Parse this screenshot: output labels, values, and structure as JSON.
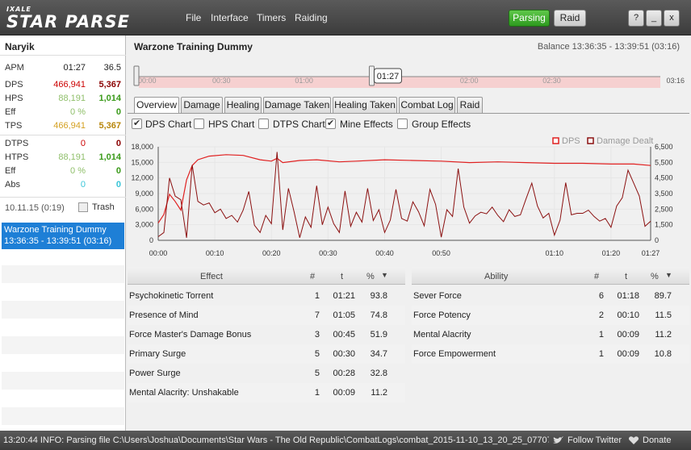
{
  "app": {
    "logo_small": "IXALE",
    "logo_big": "STAR PARSE"
  },
  "menu": [
    "File",
    "Interface",
    "Timers",
    "Raiding"
  ],
  "toolbar": {
    "parsing": "Parsing",
    "raid": "Raid",
    "help": "?",
    "minimize": "_",
    "close": "x"
  },
  "sidebar": {
    "player": "Naryik",
    "stats": [
      {
        "label": "APM",
        "v1": "01:27",
        "v2": "36.5"
      },
      {
        "label": "DPS",
        "v1": "466,941",
        "v2": "5,367"
      },
      {
        "label": "HPS",
        "v1": "88,191",
        "v2": "1,014"
      },
      {
        "label": "Eff",
        "v1": "0 %",
        "v2": "0"
      },
      {
        "label": "TPS",
        "v1": "466,941",
        "v2": "5,367"
      },
      {
        "label": "DTPS",
        "v1": "0",
        "v2": "0"
      },
      {
        "label": "HTPS",
        "v1": "88,191",
        "v2": "1,014"
      },
      {
        "label": "Eff",
        "v1": "0 %",
        "v2": "0"
      },
      {
        "label": "Abs",
        "v1": "0",
        "v2": "0"
      }
    ],
    "combat_date": "10.11.15 (0:19)",
    "trash_label": "Trash",
    "encounter": {
      "name": "Warzone Training Dummy",
      "time": "13:36:35 - 13:39:51 (03:16)"
    }
  },
  "main": {
    "title": "Warzone Training Dummy",
    "balance": "Balance 13:36:35 - 13:39:51 (03:16)",
    "timeline": {
      "ticks": [
        "00:00",
        "00:30",
        "01:00",
        "01:30",
        "02:00",
        "02:30"
      ],
      "end": "03:16",
      "cursor": "01:27",
      "cursor_fraction": 0.445
    },
    "tabs": [
      "Overview",
      "Damage",
      "Healing",
      "Damage Taken",
      "Healing Taken",
      "Combat Log",
      "Raid"
    ],
    "options": [
      {
        "label": "DPS Chart",
        "checked": true
      },
      {
        "label": "HPS Chart",
        "checked": false
      },
      {
        "label": "DTPS Chart",
        "checked": false
      },
      {
        "label": "Mine Effects",
        "checked": true
      },
      {
        "label": "Group Effects",
        "checked": false
      }
    ]
  },
  "chart_data": {
    "type": "line",
    "legend": [
      "DPS",
      "Damage Dealt"
    ],
    "colors": {
      "dps": "#e02020",
      "dealt": "#8b1010"
    },
    "x": [
      "00:00",
      "00:10",
      "00:20",
      "00:30",
      "00:40",
      "00:50",
      "01:10",
      "01:20",
      "01:27"
    ],
    "y_left_ticks": [
      "18,000",
      "15,000",
      "12,000",
      "9,000",
      "6,000",
      "3,000",
      "0"
    ],
    "y_right_ticks": [
      "6,500",
      "5,500",
      "4,500",
      "3,500",
      "2,500",
      "1,500",
      "0"
    ],
    "ylim_left": [
      0,
      18000
    ],
    "ylim_right": [
      0,
      6500
    ],
    "xlim_seconds": [
      0,
      87
    ],
    "series": [
      {
        "name": "DPS",
        "axis": "right",
        "points": [
          [
            0,
            1200
          ],
          [
            1,
            1800
          ],
          [
            2,
            3200
          ],
          [
            3,
            2700
          ],
          [
            4,
            2100
          ],
          [
            5,
            4200
          ],
          [
            6,
            5200
          ],
          [
            7,
            5600
          ],
          [
            9,
            5850
          ],
          [
            12,
            5950
          ],
          [
            15,
            5900
          ],
          [
            18,
            5600
          ],
          [
            20,
            5500
          ],
          [
            21,
            5700
          ],
          [
            22,
            5400
          ],
          [
            25,
            5550
          ],
          [
            28,
            5600
          ],
          [
            32,
            5450
          ],
          [
            35,
            5500
          ],
          [
            40,
            5600
          ],
          [
            45,
            5550
          ],
          [
            50,
            5500
          ],
          [
            55,
            5400
          ],
          [
            60,
            5450
          ],
          [
            65,
            5400
          ],
          [
            70,
            5350
          ],
          [
            75,
            5350
          ],
          [
            80,
            5300
          ],
          [
            84,
            5300
          ],
          [
            87,
            5200
          ]
        ]
      },
      {
        "name": "Damage Dealt",
        "axis": "left",
        "points": [
          [
            0,
            700
          ],
          [
            1,
            1500
          ],
          [
            2,
            12000
          ],
          [
            3,
            8500
          ],
          [
            4,
            7800
          ],
          [
            5,
            500
          ],
          [
            6,
            14500
          ],
          [
            7,
            7500
          ],
          [
            8,
            6800
          ],
          [
            9,
            7200
          ],
          [
            10,
            5300
          ],
          [
            11,
            6000
          ],
          [
            12,
            4200
          ],
          [
            13,
            4800
          ],
          [
            14,
            3500
          ],
          [
            15,
            5800
          ],
          [
            16,
            9400
          ],
          [
            17,
            2900
          ],
          [
            18,
            1500
          ],
          [
            19,
            4800
          ],
          [
            20,
            3200
          ],
          [
            21,
            17000
          ],
          [
            22,
            2000
          ],
          [
            23,
            10000
          ],
          [
            24,
            5500
          ],
          [
            25,
            500
          ],
          [
            26,
            4500
          ],
          [
            27,
            2500
          ],
          [
            28,
            10500
          ],
          [
            29,
            3000
          ],
          [
            30,
            6400
          ],
          [
            31,
            3200
          ],
          [
            32,
            1500
          ],
          [
            33,
            9500
          ],
          [
            34,
            2700
          ],
          [
            35,
            5400
          ],
          [
            36,
            3500
          ],
          [
            37,
            10000
          ],
          [
            38,
            3800
          ],
          [
            39,
            5900
          ],
          [
            40,
            1500
          ],
          [
            41,
            3900
          ],
          [
            42,
            9800
          ],
          [
            43,
            4200
          ],
          [
            44,
            3700
          ],
          [
            45,
            7400
          ],
          [
            46,
            5500
          ],
          [
            47,
            2800
          ],
          [
            48,
            9800
          ],
          [
            49,
            6900
          ],
          [
            50,
            600
          ],
          [
            51,
            5900
          ],
          [
            52,
            4600
          ],
          [
            53,
            13800
          ],
          [
            54,
            6400
          ],
          [
            55,
            3300
          ],
          [
            56,
            4700
          ],
          [
            57,
            5400
          ],
          [
            58,
            5100
          ],
          [
            59,
            6400
          ],
          [
            60,
            4800
          ],
          [
            61,
            3600
          ],
          [
            62,
            5900
          ],
          [
            63,
            4600
          ],
          [
            64,
            4900
          ],
          [
            65,
            8000
          ],
          [
            66,
            11000
          ],
          [
            67,
            6600
          ],
          [
            68,
            4300
          ],
          [
            69,
            5200
          ],
          [
            70,
            1000
          ],
          [
            71,
            3900
          ],
          [
            72,
            11100
          ],
          [
            73,
            4900
          ],
          [
            74,
            5200
          ],
          [
            75,
            5200
          ],
          [
            76,
            5800
          ],
          [
            77,
            4600
          ],
          [
            78,
            3700
          ],
          [
            79,
            4200
          ],
          [
            80,
            2500
          ],
          [
            81,
            6600
          ],
          [
            82,
            8200
          ],
          [
            83,
            13500
          ],
          [
            84,
            11000
          ],
          [
            85,
            8500
          ],
          [
            86,
            2700
          ],
          [
            87,
            3700
          ]
        ]
      }
    ]
  },
  "effects_table": {
    "headers": {
      "name": "Effect",
      "count": "#",
      "time": "t",
      "pct": "%"
    },
    "rows": [
      {
        "name": "Psychokinetic Torrent",
        "count": "1",
        "time": "01:21",
        "pct": "93.8"
      },
      {
        "name": "Presence of Mind",
        "count": "7",
        "time": "01:05",
        "pct": "74.8"
      },
      {
        "name": "Force Master's Damage Bonus",
        "count": "3",
        "time": "00:45",
        "pct": "51.9"
      },
      {
        "name": "Primary Surge",
        "count": "5",
        "time": "00:30",
        "pct": "34.7"
      },
      {
        "name": "Power Surge",
        "count": "5",
        "time": "00:28",
        "pct": "32.8"
      },
      {
        "name": "Mental Alacrity: Unshakable",
        "count": "1",
        "time": "00:09",
        "pct": "11.2"
      }
    ]
  },
  "ability_table": {
    "headers": {
      "name": "Ability",
      "count": "#",
      "time": "t",
      "pct": "%"
    },
    "rows": [
      {
        "name": "Sever Force",
        "count": "6",
        "time": "01:18",
        "pct": "89.7"
      },
      {
        "name": "Force Potency",
        "count": "2",
        "time": "00:10",
        "pct": "11.5"
      },
      {
        "name": "Mental Alacrity",
        "count": "1",
        "time": "00:09",
        "pct": "11.2"
      },
      {
        "name": "Force Empowerment",
        "count": "1",
        "time": "00:09",
        "pct": "10.8"
      }
    ]
  },
  "statusbar": {
    "message": "13:20:44 INFO: Parsing file C:\\Users\\Joshua\\Documents\\Star Wars - The Old Republic\\CombatLogs\\combat_2015-11-10_13_20_25_07707...",
    "twitter": "Follow Twitter",
    "donate": "Donate"
  }
}
